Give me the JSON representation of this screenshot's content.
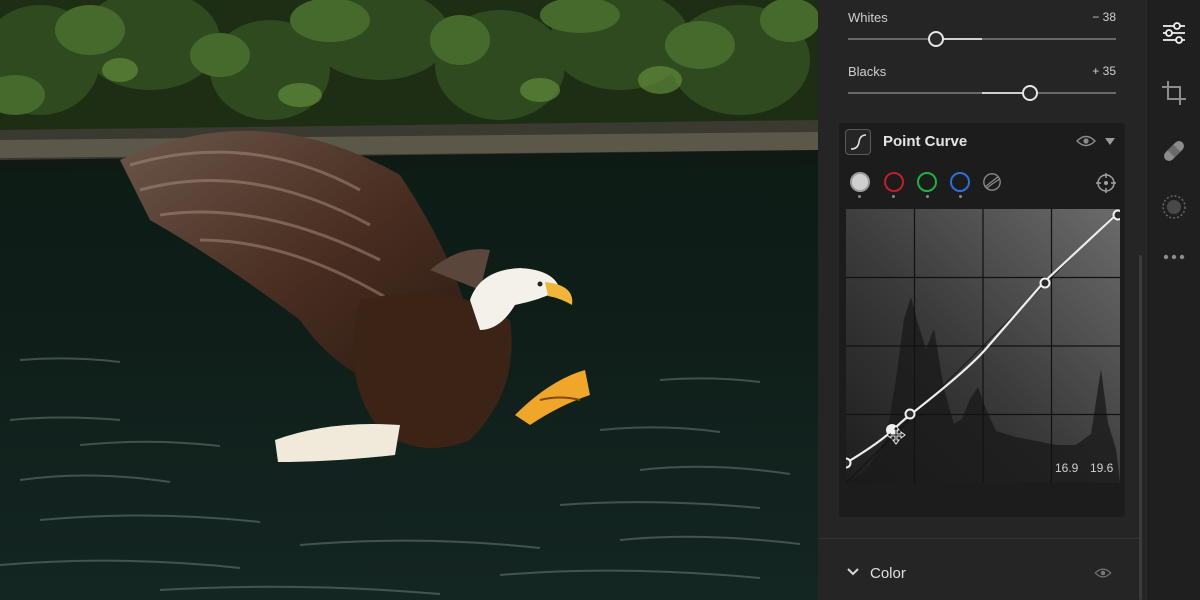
{
  "panel": {
    "whites": {
      "label": "Whites",
      "value": "− 38",
      "level": 0.33
    },
    "blacks": {
      "label": "Blacks",
      "value": "+ 35",
      "level": 0.68
    }
  },
  "point_curve": {
    "title": "Point Curve",
    "channels": [
      {
        "name": "luminance",
        "color": "#cfcfcf",
        "selected": true
      },
      {
        "name": "red",
        "color": "#c0202a",
        "selected": false
      },
      {
        "name": "green",
        "color": "#22b040",
        "selected": false
      },
      {
        "name": "blue",
        "color": "#2f6fd8",
        "selected": false
      }
    ],
    "readout_input": "16.9",
    "readout_output": "19.6"
  },
  "color_section": {
    "label": "Color"
  },
  "toolstrip": {
    "tools": [
      "edit-sliders-icon",
      "crop-icon",
      "healing-bandage-icon",
      "mask-icon",
      "more-icon"
    ]
  },
  "accent": "#e6e6e6"
}
